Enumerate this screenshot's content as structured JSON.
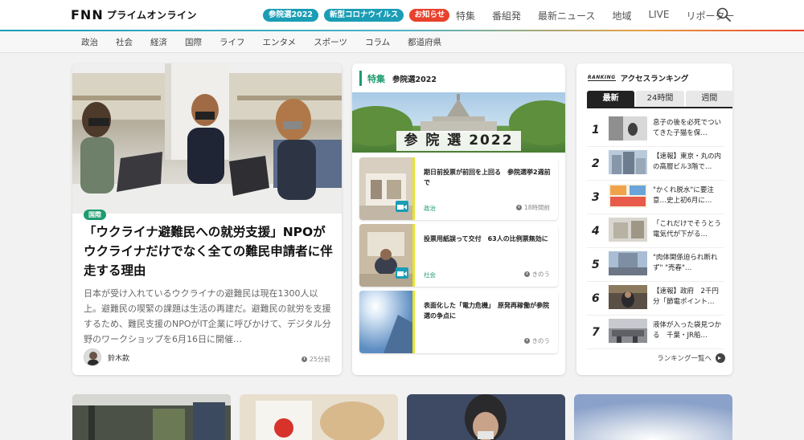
{
  "header": {
    "logo_fnn": "FNN",
    "logo_text": "プライムオンライン",
    "pills": [
      {
        "label": "参院選2022",
        "style": "teal"
      },
      {
        "label": "新型コロナウイルス",
        "style": "teal"
      },
      {
        "label": "お知らせ",
        "style": "red"
      }
    ],
    "nav": [
      "特集",
      "番組発",
      "最新ニュース",
      "地域",
      "LIVE",
      "リポーター"
    ]
  },
  "categories": [
    "政治",
    "社会",
    "経済",
    "国際",
    "ライフ",
    "エンタメ",
    "スポーツ",
    "コラム",
    "都道府県"
  ],
  "main": {
    "badge": "国際",
    "title": "「ウクライナ避難民への就労支援」NPOがウクライナだけでなく全ての難民申請者に伴走する理由",
    "summary": "日本が受け入れているウクライナの避難民は現在1300人以上。避難民の喫緊の課題は生活の再建だ。避難民の就労を支援するため、難民支援のNPOがIT企業に呼びかけて、デジタル分野のワークショップを6月16日に開催…",
    "author": "鈴木款",
    "time": "25分前"
  },
  "feature": {
    "label": "特集",
    "topic": "参院選2022",
    "banner_text": "参 院 選 2022",
    "items": [
      {
        "title": "期日前投票が前回を上回る　参院選挙2週前で",
        "category": "政治",
        "time": "18時間前"
      },
      {
        "title": "投票用紙誤って交付　63人の比例票無効に",
        "category": "社会",
        "time": "きのう"
      },
      {
        "title": "表面化した「電力危機」　原発再稼働が参院選の争点に",
        "category": "",
        "time": "きのう"
      }
    ]
  },
  "ranking": {
    "mark": "RANKING",
    "title": "アクセスランキング",
    "tabs": [
      "最新",
      "24時間",
      "週間"
    ],
    "items": [
      {
        "num": "1",
        "text": "息子の後を必死でついてきた子猫を保…"
      },
      {
        "num": "2",
        "text": "【速報】東京・丸の内の高層ビル3階で…"
      },
      {
        "num": "3",
        "text": "\"かくれ脱水\"に要注意…史上初6月に…"
      },
      {
        "num": "4",
        "text": "「これだけでそうとう電気代が下がる…"
      },
      {
        "num": "5",
        "text": "\"肉体関係迫られ断れず\" \"売春\"…"
      },
      {
        "num": "6",
        "text": "【速報】政府　2千円分「節電ポイント…"
      },
      {
        "num": "7",
        "text": "液体が入った袋見つかる　千葉・JR船…"
      }
    ],
    "more": "ランキング一覧へ"
  }
}
